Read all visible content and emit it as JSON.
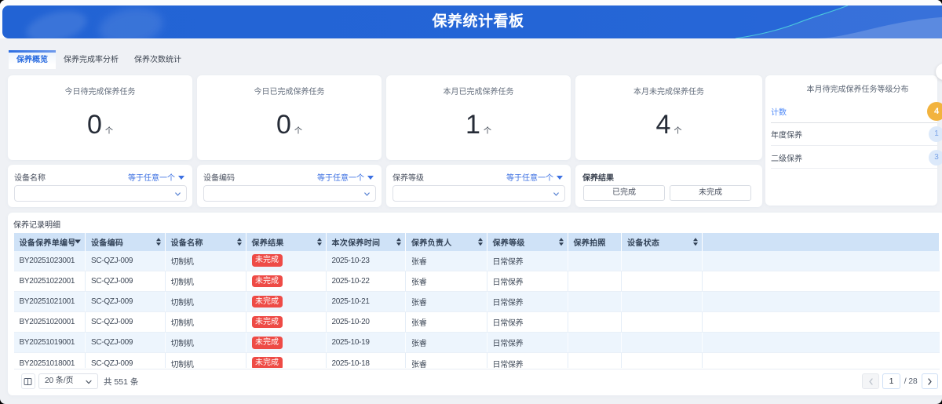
{
  "banner": {
    "title": "保养统计看板"
  },
  "colors": {
    "banner_blue": "#2465d6",
    "accent_blue": "#2b6ce0",
    "table_header_bg": "#cfe2f7",
    "row_stripe_bg": "#edf5fd",
    "badge_red": "#ee4b46",
    "badge_orange": "#f2b33e",
    "badge_light_blue": "#dce9fa",
    "page_bg": "#eff1f5"
  },
  "icons": {
    "caret-down-icon": "filled triangle pointing down",
    "chevron-down-icon": "thin chevron pointing down",
    "chevron-left-icon": "thin chevron pointing left",
    "chevron-right-icon": "thin chevron pointing right",
    "sort-icon": "stacked up and down triangles",
    "sort-desc-icon": "filled triangle pointing down",
    "columns-icon": "rectangle split by vertical line"
  },
  "tabs": [
    {
      "label": "保养概览",
      "active": true
    },
    {
      "label": "保养完成率分析",
      "active": false
    },
    {
      "label": "保养次数统计",
      "active": false
    }
  ],
  "stats": [
    {
      "label": "今日待完成保养任务",
      "value": "0",
      "unit": "个"
    },
    {
      "label": "今日已完成保养任务",
      "value": "0",
      "unit": "个"
    },
    {
      "label": "本月已完成保养任务",
      "value": "1",
      "unit": "个"
    },
    {
      "label": "本月未完成保养任务",
      "value": "4",
      "unit": "个"
    }
  ],
  "distribution": {
    "title": "本月待完成保养任务等级分布",
    "rows": [
      {
        "label": "计数",
        "value": "4",
        "highlight": true
      },
      {
        "label": "年度保养",
        "value": "1",
        "highlight": false
      },
      {
        "label": "二级保养",
        "value": "3",
        "highlight": false
      }
    ]
  },
  "filters": [
    {
      "label": "设备名称",
      "operator": "等于任意一个"
    },
    {
      "label": "设备编码",
      "operator": "等于任意一个"
    },
    {
      "label": "保养等级",
      "operator": "等于任意一个"
    }
  ],
  "result_filter": {
    "label": "保养结果",
    "options": [
      "已完成",
      "未完成"
    ]
  },
  "table": {
    "title": "保养记录明细",
    "columns": [
      {
        "label": "设备保养单编号",
        "sort": "desc"
      },
      {
        "label": "设备编码",
        "sort": "both"
      },
      {
        "label": "设备名称",
        "sort": "both"
      },
      {
        "label": "保养结果",
        "sort": "both"
      },
      {
        "label": "本次保养时间",
        "sort": "both"
      },
      {
        "label": "保养负责人",
        "sort": "both"
      },
      {
        "label": "保养等级",
        "sort": "both"
      },
      {
        "label": "保养拍照",
        "sort": "none"
      },
      {
        "label": "设备状态",
        "sort": "both"
      },
      {
        "label": "",
        "sort": "none"
      }
    ],
    "rows": [
      [
        "BY20251023001",
        "SC-QZJ-009",
        "切制机",
        "未完成",
        "2025-10-23",
        "张睿",
        "日常保养",
        "",
        "",
        ""
      ],
      [
        "BY20251022001",
        "SC-QZJ-009",
        "切制机",
        "未完成",
        "2025-10-22",
        "张睿",
        "日常保养",
        "",
        "",
        ""
      ],
      [
        "BY20251021001",
        "SC-QZJ-009",
        "切制机",
        "未完成",
        "2025-10-21",
        "张睿",
        "日常保养",
        "",
        "",
        ""
      ],
      [
        "BY20251020001",
        "SC-QZJ-009",
        "切制机",
        "未完成",
        "2025-10-20",
        "张睿",
        "日常保养",
        "",
        "",
        ""
      ],
      [
        "BY20251019001",
        "SC-QZJ-009",
        "切制机",
        "未完成",
        "2025-10-19",
        "张睿",
        "日常保养",
        "",
        "",
        ""
      ],
      [
        "BY20251018001",
        "SC-QZJ-009",
        "切制机",
        "未完成",
        "2025-10-18",
        "张睿",
        "日常保养",
        "",
        "",
        ""
      ]
    ],
    "badge_color": "#ee4b46"
  },
  "pagination": {
    "page_size": "20 条/页",
    "total": "共 551 条",
    "current_page": "1",
    "total_pages": "/ 28"
  }
}
